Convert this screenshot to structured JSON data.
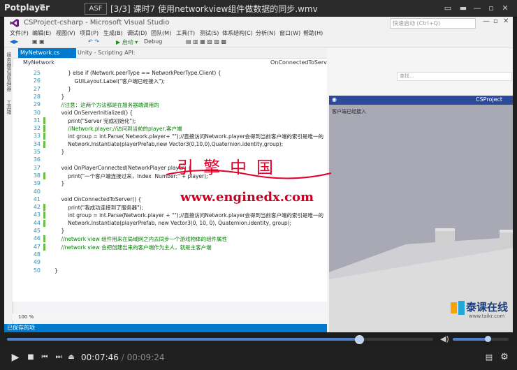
{
  "player": {
    "name": "Potplayer",
    "dropdown_glyph": "▼",
    "format": "ASF",
    "title": "[3/3] 课时7 使用networkview组件做数据的同步.wmv",
    "current_time": "00:07:46",
    "total_time": "00:09:24",
    "time_sep": "/",
    "progress_fraction": 0.827,
    "volume_fraction": 0.62,
    "accent": "#4f7fc9"
  },
  "vs": {
    "title": "CSProject-csharp - Microsoft Visual Studio",
    "quick_launch": "快速启动 (Ctrl+Q)",
    "menu": [
      "文件(F)",
      "编辑(E)",
      "视图(V)",
      "项目(P)",
      "生成(B)",
      "调试(D)",
      "团队(M)",
      "工具(T)",
      "测试(S)",
      "体系结构(C)",
      "分析(N)",
      "窗口(W)",
      "帮助(H)"
    ],
    "toolbar_start": "▶ 启动 ▾",
    "toolbar_config": "Debug",
    "left_tabs": [
      "服务器资源管理器",
      "工具箱"
    ],
    "doc_tab_active": "MyNetwork.cs",
    "doc_tab_inactive": "Unity - Scripting API:",
    "nav_left": "MyNetwork",
    "nav_right": "OnConnectedToServer()",
    "zoom": "100 %",
    "status": "已保存的项",
    "search_box": "查找..."
  },
  "code_lines": [
    {
      "n": "25",
      "t": "        } else if (Network.peerType == NetworkPeerType.Client) {",
      "c": "#222",
      "g": false
    },
    {
      "n": "26",
      "t": "            GUILayout.Label(\"客户端已经接入\");",
      "c": "#222",
      "g": false
    },
    {
      "n": "27",
      "t": "        }",
      "c": "#222",
      "g": false
    },
    {
      "n": "28",
      "t": "    }",
      "c": "#222",
      "g": false
    },
    {
      "n": "29",
      "t": "    //注意：这两个方法都是在服务器端调用的",
      "c": "#008000",
      "g": false
    },
    {
      "n": "30",
      "t": "    void OnServerInitialized() {",
      "c": "#222",
      "g": false
    },
    {
      "n": "31",
      "t": "        print(\"Server 完成初始化\");",
      "c": "#222",
      "g": true
    },
    {
      "n": "32",
      "t": "        //Network.player;//访问到当前的player,客户端",
      "c": "#008000",
      "g": true
    },
    {
      "n": "33",
      "t": "        int group = int.Parse( Network.player+ \"\");//直接访问Network.player会得到当前客户端的索引是唯一的",
      "c": "#222",
      "g": true
    },
    {
      "n": "34",
      "t": "        Network.Instantiate(playerPrefab,new Vector3(0,10,0),Quaternion.identity,group);",
      "c": "#222",
      "g": true
    },
    {
      "n": "35",
      "t": "    }",
      "c": "#222",
      "g": false
    },
    {
      "n": "36",
      "t": "",
      "c": "#222",
      "g": false
    },
    {
      "n": "37",
      "t": "    void OnPlayerConnected(NetworkPlayer player) {",
      "c": "#222",
      "g": false
    },
    {
      "n": "38",
      "t": "        print(\"一个客户端连接过来，Index  Number:\" + player);",
      "c": "#222",
      "g": true
    },
    {
      "n": "39",
      "t": "    }",
      "c": "#222",
      "g": false
    },
    {
      "n": "40",
      "t": "",
      "c": "#222",
      "g": false
    },
    {
      "n": "41",
      "t": "    void OnConnectedToServer() {",
      "c": "#222",
      "g": false
    },
    {
      "n": "42",
      "t": "        print(\"我成功连接到了服务器\");",
      "c": "#222",
      "g": true
    },
    {
      "n": "43",
      "t": "        int group = int.Parse(Network.player + \"\");//直接访问Network.player会得到当前客户端的索引是唯一的",
      "c": "#222",
      "g": true
    },
    {
      "n": "44",
      "t": "        Network.Instantiate(playerPrefab, new Vector3(0, 10, 0), Quaternion.identity, group);",
      "c": "#222",
      "g": true
    },
    {
      "n": "45",
      "t": "    }",
      "c": "#222",
      "g": false
    },
    {
      "n": "46",
      "t": "    //network view 组件用来在局域网之内去同步一个游戏物体的组件属性",
      "c": "#008000",
      "g": true
    },
    {
      "n": "47",
      "t": "    //network view 会把创建出来的客户端作为主人，就是主客户端",
      "c": "#008000",
      "g": true
    },
    {
      "n": "48",
      "t": "",
      "c": "#222",
      "g": false
    },
    {
      "n": "49",
      "t": "",
      "c": "#222",
      "g": false
    },
    {
      "n": "50",
      "t": "}",
      "c": "#222",
      "g": false
    }
  ],
  "game": {
    "title": "CSProject",
    "note": "客户端已经接入",
    "sky": "#a9a8b5",
    "ground": "#dcdcdc"
  },
  "watermark": {
    "line1": "引擎中国",
    "url": "www.enginedx.com",
    "brand": "泰课在线",
    "brand_url": "www.taikr.com"
  }
}
